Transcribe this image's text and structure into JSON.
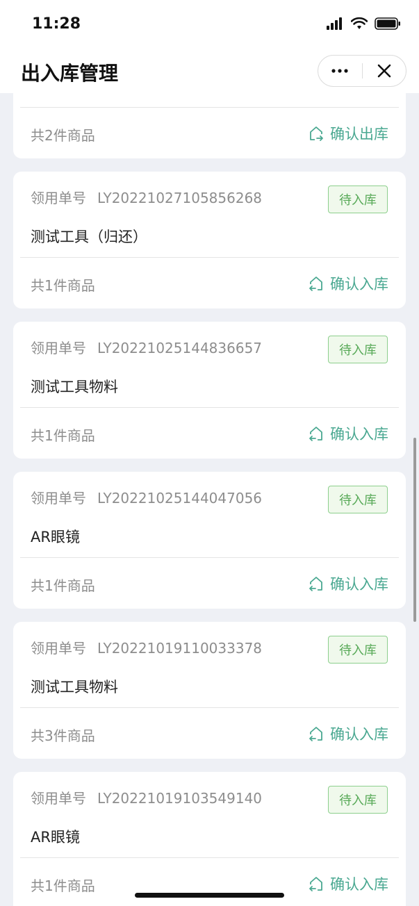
{
  "status_bar": {
    "time": "11:28"
  },
  "nav": {
    "title": "出入库管理"
  },
  "labels": {
    "order_no_label": "领用单号"
  },
  "first_card": {
    "count": "共2件商品",
    "action": "确认出库"
  },
  "orders": [
    {
      "order_no": "LY20221027105856268",
      "status": "待入库",
      "item": "测试工具（归还）",
      "count": "共1件商品",
      "action": "确认入库"
    },
    {
      "order_no": "LY20221025144836657",
      "status": "待入库",
      "item": "测试工具物料",
      "count": "共1件商品",
      "action": "确认入库"
    },
    {
      "order_no": "LY20221025144047056",
      "status": "待入库",
      "item": "AR眼镜",
      "count": "共1件商品",
      "action": "确认入库"
    },
    {
      "order_no": "LY20221019110033378",
      "status": "待入库",
      "item": "测试工具物料",
      "count": "共3件商品",
      "action": "确认入库"
    },
    {
      "order_no": "LY20221019103549140",
      "status": "待入库",
      "item": "AR眼镜",
      "count": "共1件商品",
      "action": "确认入库"
    }
  ],
  "colors": {
    "accent": "#4aa891",
    "badge_green": "#57a957",
    "background": "#eef0f5"
  }
}
